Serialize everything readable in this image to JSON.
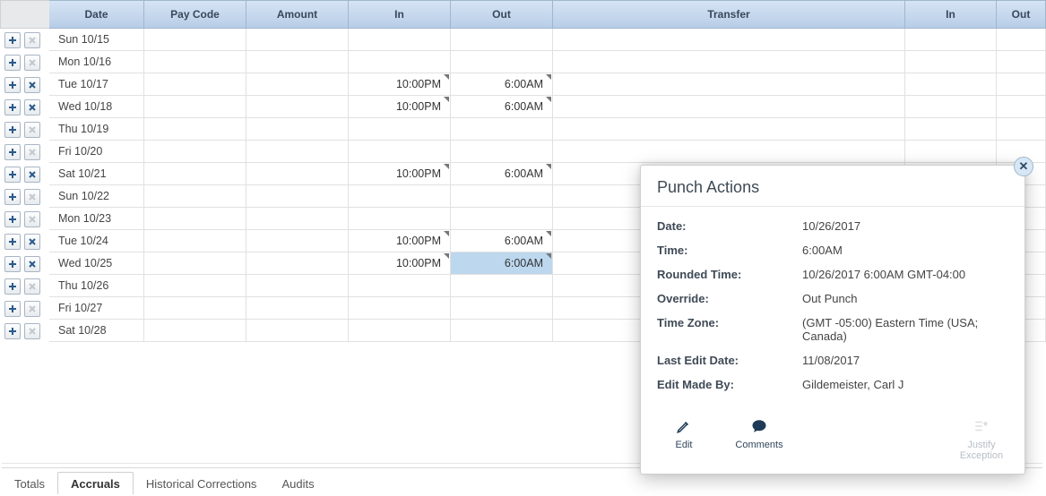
{
  "columns": {
    "date": "Date",
    "paycode": "Pay Code",
    "amount": "Amount",
    "in": "In",
    "out": "Out",
    "transfer": "Transfer",
    "in2": "In",
    "out2": "Out"
  },
  "rows": [
    {
      "date": "Sun 10/15",
      "in": "",
      "out": "",
      "del": false
    },
    {
      "date": "Mon 10/16",
      "in": "",
      "out": "",
      "del": false
    },
    {
      "date": "Tue 10/17",
      "in": "10:00PM",
      "out": "6:00AM",
      "del": true
    },
    {
      "date": "Wed 10/18",
      "in": "10:00PM",
      "out": "6:00AM",
      "del": true
    },
    {
      "date": "Thu 10/19",
      "in": "",
      "out": "",
      "del": false
    },
    {
      "date": "Fri 10/20",
      "in": "",
      "out": "",
      "del": false
    },
    {
      "date": "Sat 10/21",
      "in": "10:00PM",
      "out": "6:00AM",
      "del": true
    },
    {
      "date": "Sun 10/22",
      "in": "",
      "out": "",
      "del": false
    },
    {
      "date": "Mon 10/23",
      "in": "",
      "out": "",
      "del": false
    },
    {
      "date": "Tue 10/24",
      "in": "10:00PM",
      "out": "6:00AM",
      "del": true
    },
    {
      "date": "Wed 10/25",
      "in": "10:00PM",
      "out": "6:00AM",
      "del": true,
      "selOut": true
    },
    {
      "date": "Thu 10/26",
      "in": "",
      "out": "",
      "del": false
    },
    {
      "date": "Fri 10/27",
      "in": "",
      "out": "",
      "del": false
    },
    {
      "date": "Sat 10/28",
      "in": "",
      "out": "",
      "del": false
    }
  ],
  "tabs": {
    "totals": "Totals",
    "accruals": "Accruals",
    "historical": "Historical Corrections",
    "audits": "Audits"
  },
  "popup": {
    "title": "Punch Actions",
    "labels": {
      "date": "Date:",
      "time": "Time:",
      "rounded": "Rounded Time:",
      "override": "Override:",
      "tz": "Time Zone:",
      "lastedit": "Last Edit Date:",
      "editby": "Edit Made By:"
    },
    "values": {
      "date": "10/26/2017",
      "time": "6:00AM",
      "rounded": "10/26/2017 6:00AM GMT-04:00",
      "override": "Out Punch",
      "tz": "(GMT -05:00) Eastern Time (USA; Canada)",
      "lastedit": "11/08/2017",
      "editby": "Gildemeister, Carl J"
    },
    "actions": {
      "edit": "Edit",
      "comments": "Comments",
      "justify": "Justify Exception"
    }
  }
}
